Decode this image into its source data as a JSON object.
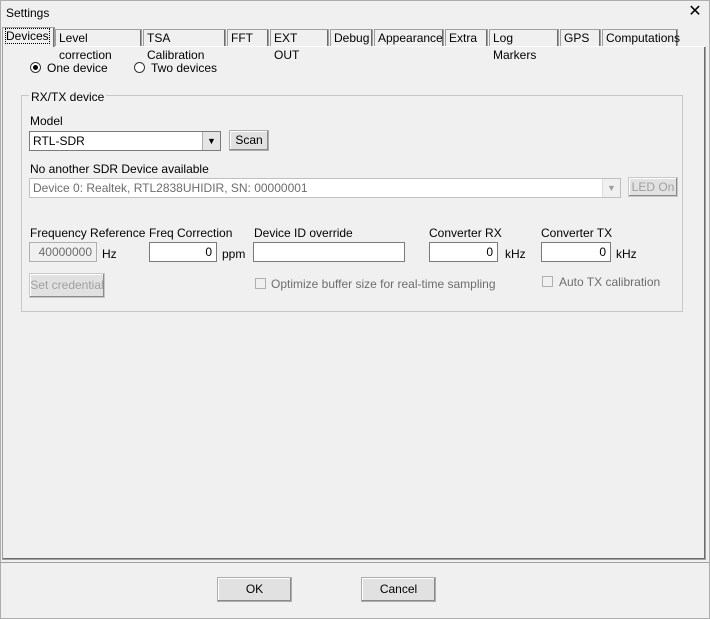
{
  "window": {
    "title": "Settings"
  },
  "tabs": [
    "Devices",
    "Level correction",
    "TSA Calibration",
    "FFT",
    "EXT OUT",
    "Debug",
    "Appearance",
    "Extra",
    "Log Markers",
    "GPS",
    "Computations"
  ],
  "mode": {
    "one": "One device",
    "two": "Two devices",
    "selected": "one"
  },
  "group": {
    "label": "RX/TX device",
    "model_label": "Model",
    "model_value": "RTL-SDR",
    "scan": "Scan",
    "status": "No another SDR Device available",
    "device_value": "Device 0:  Realtek, RTL2838UHIDIR, SN: 00000001",
    "led": "LED On",
    "freq_ref_label": "Frequency Reference",
    "freq_ref_value": "40000000",
    "freq_ref_unit": "Hz",
    "freq_corr_label": "Freq Correction",
    "freq_corr_value": "0",
    "freq_corr_unit": "ppm",
    "device_id_label": "Device ID override",
    "device_id_value": "",
    "conv_rx_label": "Converter RX",
    "conv_rx_value": "0",
    "conv_rx_unit": "kHz",
    "conv_tx_label": "Converter TX",
    "conv_tx_value": "0",
    "conv_tx_unit": "kHz",
    "set_credential": "Set credential",
    "optimize": "Optimize buffer size for real-time sampling",
    "auto_tx": "Auto TX calibration"
  },
  "footer": {
    "ok": "OK",
    "cancel": "Cancel"
  }
}
